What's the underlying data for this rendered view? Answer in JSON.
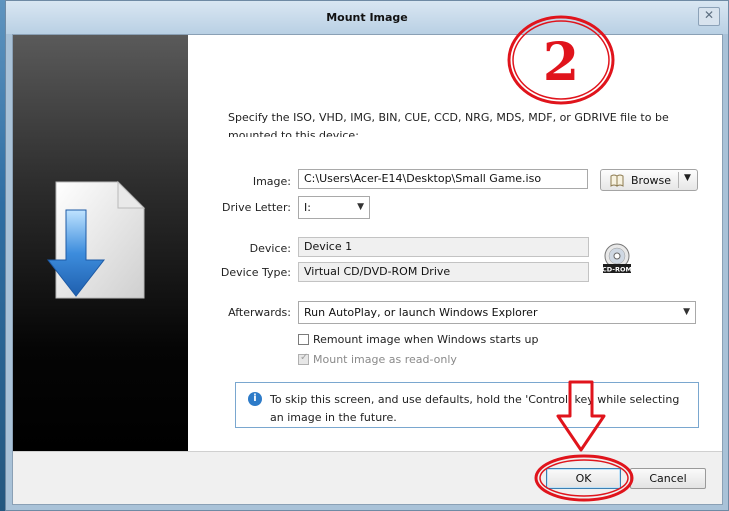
{
  "window": {
    "title": "Mount Image",
    "close_glyph": "✕"
  },
  "intro_text": "Specify the ISO, VHD, IMG, BIN, CUE, CCD, NRG, MDS, MDF, or GDRIVE file to be mounted to this device:",
  "form": {
    "image_label": "Image:",
    "image_value": "C:\\Users\\Acer-E14\\Desktop\\Small Game.iso",
    "browse_label": "Browse",
    "drive_letter_label": "Drive Letter:",
    "drive_letter_value": "I:",
    "device_label": "Device:",
    "device_value": "Device 1",
    "device_type_label": "Device Type:",
    "device_type_value": "Virtual CD/DVD-ROM Drive",
    "cd_icon_text": "CD-ROM",
    "afterwards_label": "Afterwards:",
    "afterwards_value": "Run AutoPlay, or launch Windows Explorer",
    "remount_label": "Remount image when Windows starts up",
    "remount_checked": false,
    "readonly_label": "Mount image as read-only",
    "readonly_checked": true
  },
  "info": {
    "text": "To skip this screen, and use defaults, hold the 'Control' key while selecting an image in the future."
  },
  "buttons": {
    "ok": "OK",
    "cancel": "Cancel"
  },
  "annotation": {
    "step_number": "2"
  },
  "colors": {
    "annotation_red": "#e0141c",
    "info_blue": "#2d7bc8",
    "accent_blue": "#3c7fb1"
  }
}
